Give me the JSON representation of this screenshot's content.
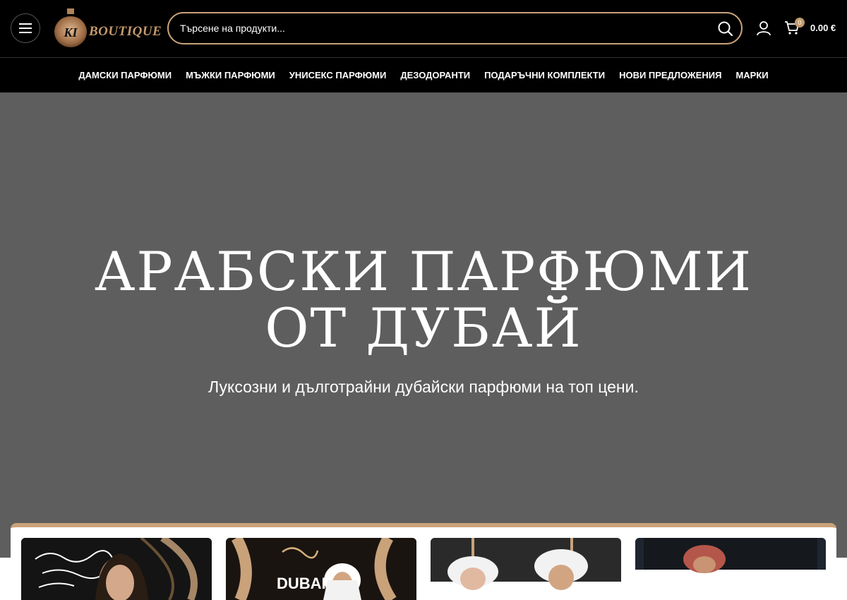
{
  "header": {
    "logo_mark": "KI",
    "logo_word": "BOUTIQUE",
    "search_placeholder": "Търсене на продукти...",
    "cart_count": "0",
    "cart_total": "0.00 €"
  },
  "nav": {
    "items": [
      {
        "label": "ДАМСКИ ПАРФЮМИ"
      },
      {
        "label": "МЪЖКИ ПАРФЮМИ"
      },
      {
        "label": "УНИСЕКС ПАРФЮМИ"
      },
      {
        "label": "ДЕЗОДОРАНТИ"
      },
      {
        "label": "ПОДАРЪЧНИ КОМПЛЕКТИ"
      },
      {
        "label": "НОВИ ПРЕДЛОЖЕНИЯ"
      },
      {
        "label": "МАРКИ"
      }
    ]
  },
  "hero": {
    "title_line1": "АРАБСКИ ПАРФЮМИ",
    "title_line2": "ОТ ДУБАЙ",
    "subtitle": "Луксозни и дълготрайни дубайски парфюми на топ цени."
  },
  "cards": {
    "card2_text": "DUBAI"
  },
  "colors": {
    "accent_gold": "#c9a27a",
    "header_bg": "#000000",
    "hero_bg": "#5e5e5e"
  }
}
